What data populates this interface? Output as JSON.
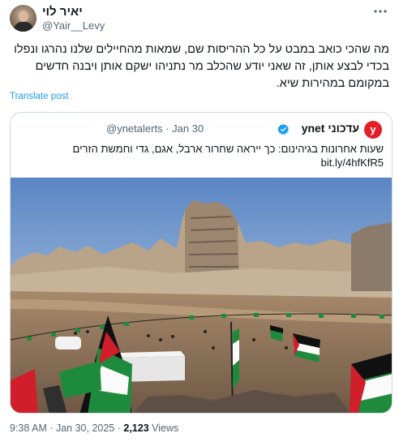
{
  "author": {
    "name": "יאיר לוי",
    "handle": "@Yair__Levy"
  },
  "tweet": {
    "text": "מה שהכי כואב במבט על כל ההריסות שם, שמאות מהחיילים שלנו נהרגו ונפלו בכדי לבצע אותן, זה שאני יודע שהכלב מר נתניהו ישקם אותן ויבנה חדשים במקומם במהירות שיא.",
    "translate_label": "Translate post"
  },
  "quote": {
    "logo_text": "y",
    "name": "ynet עדכוני",
    "handle_date": "@ynetalerts · Jan 30",
    "text": "שעות אחרונות בגיהינום: כך ייראה שחרור ארבל, אגם, גדי וחמשת הזרים",
    "link": "bit.ly/4hfKfR5"
  },
  "footer": {
    "time_date": "9:38 AM · Jan 30, 2025 · ",
    "views_count": "2,123",
    "views_label": " Views"
  },
  "icons": {
    "more": "more-horizontal-icon",
    "verified": "verified-badge-icon"
  },
  "colors": {
    "link": "#1d9bf0",
    "ynet_red": "#e41e26",
    "secondary_text": "#536471"
  }
}
